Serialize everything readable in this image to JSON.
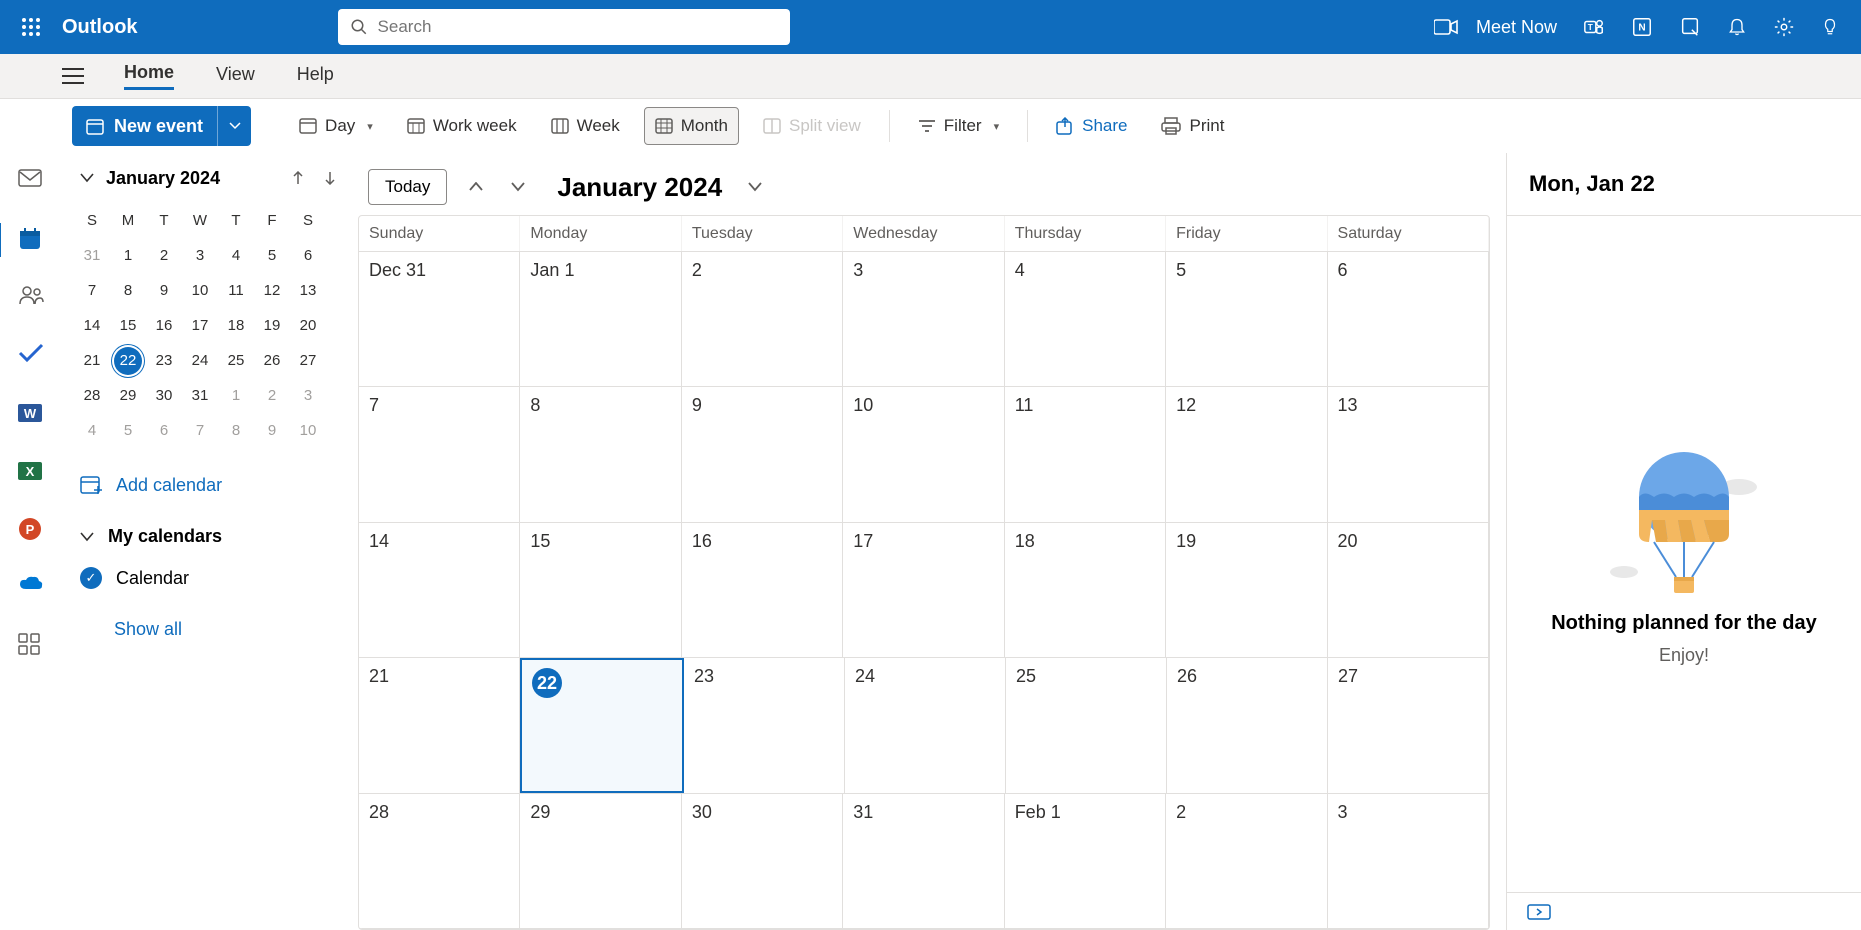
{
  "brand": "Outlook",
  "search": {
    "placeholder": "Search"
  },
  "header": {
    "meetNow": "Meet Now"
  },
  "menuTabs": {
    "home": "Home",
    "view": "View",
    "help": "Help"
  },
  "toolbar": {
    "newEvent": "New event",
    "day": "Day",
    "workWeek": "Work week",
    "week": "Week",
    "month": "Month",
    "splitView": "Split view",
    "filter": "Filter",
    "share": "Share",
    "print": "Print"
  },
  "miniCal": {
    "title": "January 2024",
    "headers": [
      "S",
      "M",
      "T",
      "W",
      "T",
      "F",
      "S"
    ],
    "weeks": [
      [
        {
          "d": "31",
          "dim": true
        },
        {
          "d": "1"
        },
        {
          "d": "2"
        },
        {
          "d": "3"
        },
        {
          "d": "4"
        },
        {
          "d": "5"
        },
        {
          "d": "6"
        }
      ],
      [
        {
          "d": "7"
        },
        {
          "d": "8"
        },
        {
          "d": "9"
        },
        {
          "d": "10"
        },
        {
          "d": "11"
        },
        {
          "d": "12"
        },
        {
          "d": "13"
        }
      ],
      [
        {
          "d": "14"
        },
        {
          "d": "15"
        },
        {
          "d": "16"
        },
        {
          "d": "17"
        },
        {
          "d": "18"
        },
        {
          "d": "19"
        },
        {
          "d": "20"
        }
      ],
      [
        {
          "d": "21"
        },
        {
          "d": "22",
          "today": true
        },
        {
          "d": "23"
        },
        {
          "d": "24"
        },
        {
          "d": "25"
        },
        {
          "d": "26"
        },
        {
          "d": "27"
        }
      ],
      [
        {
          "d": "28"
        },
        {
          "d": "29"
        },
        {
          "d": "30"
        },
        {
          "d": "31"
        },
        {
          "d": "1",
          "dim": true
        },
        {
          "d": "2",
          "dim": true
        },
        {
          "d": "3",
          "dim": true
        }
      ],
      [
        {
          "d": "4",
          "dim": true
        },
        {
          "d": "5",
          "dim": true
        },
        {
          "d": "6",
          "dim": true
        },
        {
          "d": "7",
          "dim": true
        },
        {
          "d": "8",
          "dim": true
        },
        {
          "d": "9",
          "dim": true
        },
        {
          "d": "10",
          "dim": true
        }
      ]
    ]
  },
  "sidebar": {
    "addCalendar": "Add calendar",
    "myCalendars": "My calendars",
    "calendarItem": "Calendar",
    "showAll": "Show all"
  },
  "bigCal": {
    "today": "Today",
    "title": "January 2024",
    "dows": [
      "Sunday",
      "Monday",
      "Tuesday",
      "Wednesday",
      "Thursday",
      "Friday",
      "Saturday"
    ],
    "weeks": [
      [
        {
          "l": "Dec 31"
        },
        {
          "l": "Jan 1"
        },
        {
          "l": "2"
        },
        {
          "l": "3"
        },
        {
          "l": "4"
        },
        {
          "l": "5"
        },
        {
          "l": "6"
        }
      ],
      [
        {
          "l": "7"
        },
        {
          "l": "8"
        },
        {
          "l": "9"
        },
        {
          "l": "10"
        },
        {
          "l": "11"
        },
        {
          "l": "12"
        },
        {
          "l": "13"
        }
      ],
      [
        {
          "l": "14"
        },
        {
          "l": "15"
        },
        {
          "l": "16"
        },
        {
          "l": "17"
        },
        {
          "l": "18"
        },
        {
          "l": "19"
        },
        {
          "l": "20"
        }
      ],
      [
        {
          "l": "21"
        },
        {
          "l": "22",
          "today": true
        },
        {
          "l": "23"
        },
        {
          "l": "24"
        },
        {
          "l": "25"
        },
        {
          "l": "26"
        },
        {
          "l": "27"
        }
      ],
      [
        {
          "l": "28"
        },
        {
          "l": "29"
        },
        {
          "l": "30"
        },
        {
          "l": "31"
        },
        {
          "l": "Feb 1"
        },
        {
          "l": "2"
        },
        {
          "l": "3"
        }
      ]
    ]
  },
  "rightPane": {
    "title": "Mon, Jan 22",
    "message": "Nothing planned for the day",
    "subtitle": "Enjoy!"
  }
}
